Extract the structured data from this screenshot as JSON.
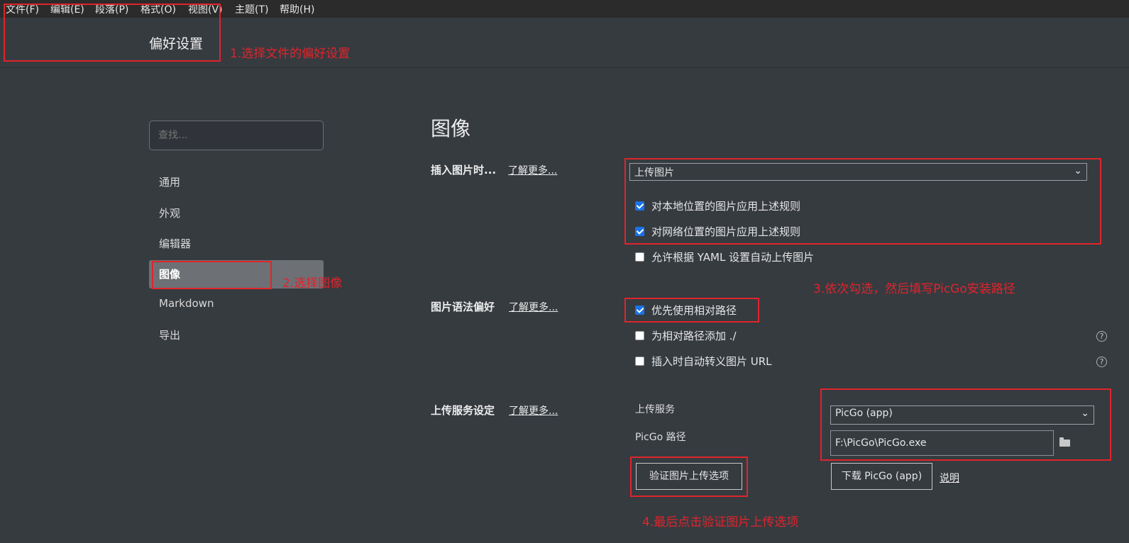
{
  "menubar": {
    "items": [
      "文件(F)",
      "编辑(E)",
      "段落(P)",
      "格式(O)",
      "视图(V)",
      "主题(T)",
      "帮助(H)"
    ]
  },
  "window": {
    "title": "偏好设置"
  },
  "sidebar": {
    "search_placeholder": "查找...",
    "items": [
      "通用",
      "外观",
      "编辑器",
      "图像",
      "Markdown",
      "导出"
    ],
    "active": "图像"
  },
  "main": {
    "heading": "图像",
    "insert_section": {
      "label": "插入图片时...",
      "learn_more": "了解更多...",
      "select_value": "上传图片",
      "options": [
        {
          "label": "对本地位置的图片应用上述规则",
          "checked": true
        },
        {
          "label": "对网络位置的图片应用上述规则",
          "checked": true
        },
        {
          "label": "允许根据 YAML 设置自动上传图片",
          "checked": false
        }
      ]
    },
    "syntax_section": {
      "label": "图片语法偏好",
      "learn_more": "了解更多...",
      "options": [
        {
          "label": "优先使用相对路径",
          "checked": true
        },
        {
          "label": "为相对路径添加 ./",
          "checked": false,
          "help": "?"
        },
        {
          "label": "插入时自动转义图片 URL",
          "checked": false,
          "help": "?"
        }
      ]
    },
    "upload_section": {
      "label": "上传服务设定",
      "learn_more": "了解更多...",
      "service_label": "上传服务",
      "service_value": "PicGo (app)",
      "path_label": "PicGo 路径",
      "path_value": "F:\\PicGo\\PicGo.exe",
      "verify_button": "验证图片上传选项",
      "download_button": "下载 PicGo (app)",
      "explain_link": "说明"
    }
  },
  "annotations": {
    "note1": "1.选择文件的偏好设置",
    "note2": "2.选择图像",
    "note3": "3.依次勾选，然后填写PicGo安装路径",
    "note4": "4.最后点击验证图片上传选项",
    "color": "#e0242b"
  }
}
